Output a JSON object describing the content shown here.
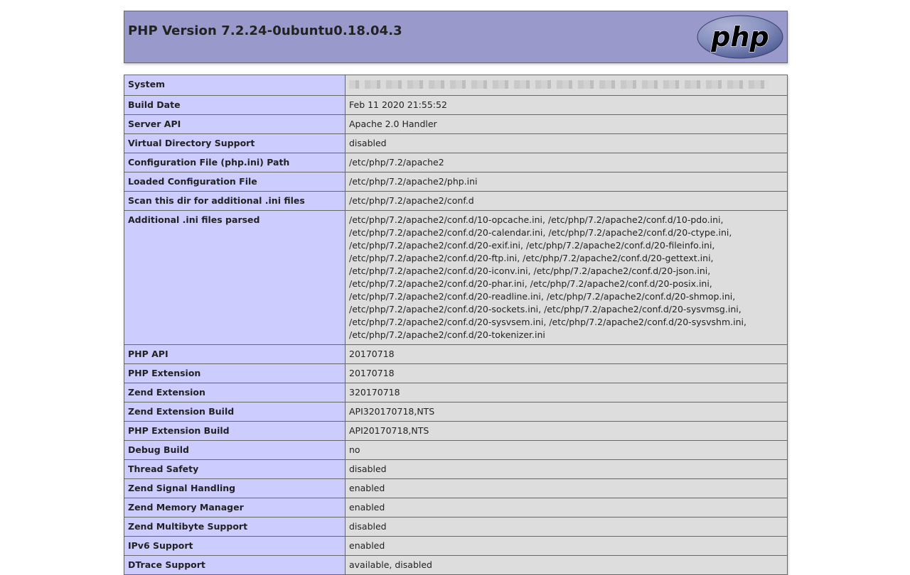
{
  "header": {
    "title": "PHP Version 7.2.24-0ubuntu0.18.04.3",
    "logo_text": "php"
  },
  "rows": [
    {
      "key": "System",
      "value": "",
      "redacted": true
    },
    {
      "key": "Build Date",
      "value": "Feb 11 2020 21:55:52"
    },
    {
      "key": "Server API",
      "value": "Apache 2.0 Handler"
    },
    {
      "key": "Virtual Directory Support",
      "value": "disabled"
    },
    {
      "key": "Configuration File (php.ini) Path",
      "value": "/etc/php/7.2/apache2"
    },
    {
      "key": "Loaded Configuration File",
      "value": "/etc/php/7.2/apache2/php.ini"
    },
    {
      "key": "Scan this dir for additional .ini files",
      "value": "/etc/php/7.2/apache2/conf.d"
    },
    {
      "key": "Additional .ini files parsed",
      "lines": [
        "/etc/php/7.2/apache2/conf.d/10-opcache.ini, /etc/php/7.2/apache2/conf.d/10-pdo.ini,",
        "/etc/php/7.2/apache2/conf.d/20-calendar.ini, /etc/php/7.2/apache2/conf.d/20-ctype.ini,",
        "/etc/php/7.2/apache2/conf.d/20-exif.ini, /etc/php/7.2/apache2/conf.d/20-fileinfo.ini,",
        "/etc/php/7.2/apache2/conf.d/20-ftp.ini, /etc/php/7.2/apache2/conf.d/20-gettext.ini,",
        "/etc/php/7.2/apache2/conf.d/20-iconv.ini, /etc/php/7.2/apache2/conf.d/20-json.ini,",
        "/etc/php/7.2/apache2/conf.d/20-phar.ini, /etc/php/7.2/apache2/conf.d/20-posix.ini,",
        "/etc/php/7.2/apache2/conf.d/20-readline.ini, /etc/php/7.2/apache2/conf.d/20-shmop.ini,",
        "/etc/php/7.2/apache2/conf.d/20-sockets.ini, /etc/php/7.2/apache2/conf.d/20-sysvmsg.ini,",
        "/etc/php/7.2/apache2/conf.d/20-sysvsem.ini, /etc/php/7.2/apache2/conf.d/20-sysvshm.ini,",
        "/etc/php/7.2/apache2/conf.d/20-tokenizer.ini"
      ]
    },
    {
      "key": "PHP API",
      "value": "20170718"
    },
    {
      "key": "PHP Extension",
      "value": "20170718"
    },
    {
      "key": "Zend Extension",
      "value": "320170718"
    },
    {
      "key": "Zend Extension Build",
      "value": "API320170718,NTS"
    },
    {
      "key": "PHP Extension Build",
      "value": "API20170718,NTS"
    },
    {
      "key": "Debug Build",
      "value": "no"
    },
    {
      "key": "Thread Safety",
      "value": "disabled"
    },
    {
      "key": "Zend Signal Handling",
      "value": "enabled"
    },
    {
      "key": "Zend Memory Manager",
      "value": "enabled"
    },
    {
      "key": "Zend Multibyte Support",
      "value": "disabled"
    },
    {
      "key": "IPv6 Support",
      "value": "enabled"
    },
    {
      "key": "DTrace Support",
      "value": "available, disabled"
    }
  ],
  "colors": {
    "header_bg": "#9999cc",
    "key_bg": "#ccccff",
    "value_bg": "#dddddd",
    "border": "#666666",
    "logo_bg": "#8892bf",
    "logo_text": "#000000"
  }
}
